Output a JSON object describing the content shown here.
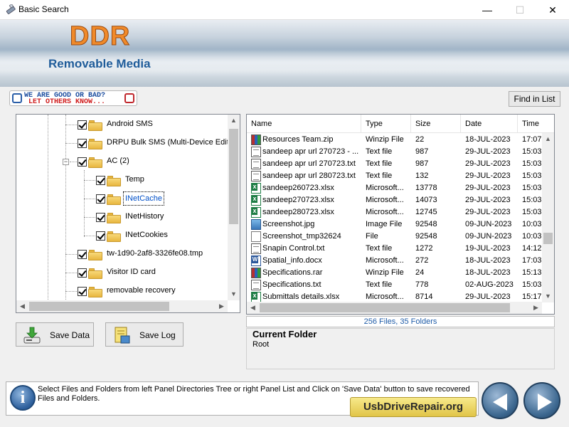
{
  "window": {
    "title": "Basic Search",
    "minimize_glyph": "—",
    "maximize_glyph": "☐",
    "close_glyph": "✕"
  },
  "banner": {
    "brand": "DDR",
    "subtitle": "Removable Media"
  },
  "promo": {
    "line1": "WE ARE GOOD OR BAD?",
    "line2": "LET OTHERS KNOW..."
  },
  "toolbar": {
    "find_label": "Find in List"
  },
  "tree": {
    "items": [
      {
        "label": "Android SMS",
        "checked": true
      },
      {
        "label": "DRPU Bulk SMS (Multi-Device Edition",
        "checked": true
      },
      {
        "label": "AC (2)",
        "checked": true,
        "expanded": true
      },
      {
        "label": "Temp",
        "checked": true
      },
      {
        "label": "INetCache",
        "checked": true,
        "selected": true
      },
      {
        "label": "INetHistory",
        "checked": true
      },
      {
        "label": "INetCookies",
        "checked": true
      },
      {
        "label": "tw-1d90-2af8-3326fe08.tmp",
        "checked": true
      },
      {
        "label": "Visitor ID card",
        "checked": true
      },
      {
        "label": "removable recovery",
        "checked": true
      }
    ],
    "expander_glyph": "−"
  },
  "actions": {
    "save_data": "Save Data",
    "save_log": "Save Log"
  },
  "file_list": {
    "columns": [
      "Name",
      "Type",
      "Size",
      "Date",
      "Time"
    ],
    "rows": [
      {
        "icon": "zip-icon",
        "name": "Resources Team.zip",
        "type": "Winzip File",
        "size": "22",
        "date": "18-JUL-2023",
        "time": "17:07"
      },
      {
        "icon": "text-file-icon",
        "name": "sandeep apr url 270723 - ...",
        "type": "Text file",
        "size": "987",
        "date": "29-JUL-2023",
        "time": "15:03"
      },
      {
        "icon": "text-file-icon",
        "name": "sandeep apr url 270723.txt",
        "type": "Text file",
        "size": "987",
        "date": "29-JUL-2023",
        "time": "15:03"
      },
      {
        "icon": "text-file-icon",
        "name": "sandeep apr url 280723.txt",
        "type": "Text file",
        "size": "132",
        "date": "29-JUL-2023",
        "time": "15:03"
      },
      {
        "icon": "excel-icon",
        "name": "sandeep260723.xlsx",
        "type": "Microsoft...",
        "size": "13778",
        "date": "29-JUL-2023",
        "time": "15:03"
      },
      {
        "icon": "excel-icon",
        "name": "sandeep270723.xlsx",
        "type": "Microsoft...",
        "size": "14073",
        "date": "29-JUL-2023",
        "time": "15:03"
      },
      {
        "icon": "excel-icon",
        "name": "sandeep280723.xlsx",
        "type": "Microsoft...",
        "size": "12745",
        "date": "29-JUL-2023",
        "time": "15:03"
      },
      {
        "icon": "image-icon",
        "name": "Screenshot.jpg",
        "type": "Image File",
        "size": "92548",
        "date": "09-JUN-2023",
        "time": "10:03"
      },
      {
        "icon": "file-icon",
        "name": "Screenshot_tmp32624",
        "type": "File",
        "size": "92548",
        "date": "09-JUN-2023",
        "time": "10:03"
      },
      {
        "icon": "text-file-icon",
        "name": "Snapin Control.txt",
        "type": "Text file",
        "size": "1272",
        "date": "19-JUL-2023",
        "time": "14:12"
      },
      {
        "icon": "word-icon",
        "name": "Spatial_info.docx",
        "type": "Microsoft...",
        "size": "272",
        "date": "18-JUL-2023",
        "time": "17:03"
      },
      {
        "icon": "zip-icon",
        "name": "Specifications.rar",
        "type": "Winzip File",
        "size": "24",
        "date": "18-JUL-2023",
        "time": "15:13"
      },
      {
        "icon": "text-file-icon",
        "name": "Specifications.txt",
        "type": "Text file",
        "size": "778",
        "date": "02-AUG-2023",
        "time": "15:03"
      },
      {
        "icon": "excel-icon",
        "name": "Submittals details.xlsx",
        "type": "Microsoft...",
        "size": "8714",
        "date": "29-JUL-2023",
        "time": "15:17"
      }
    ]
  },
  "status": {
    "summary": "256 Files, 35 Folders"
  },
  "current_folder": {
    "title": "Current Folder",
    "value": "Root"
  },
  "info": {
    "icon_glyph": "i",
    "text": "Select Files and Folders from left Panel Directories Tree or right Panel List and Click on 'Save Data' button to save recovered Files and Folders.",
    "site": "UsbDriveRepair.org"
  },
  "scroll": {
    "up": "▲",
    "down": "▼",
    "left": "◀",
    "right": "▶"
  }
}
